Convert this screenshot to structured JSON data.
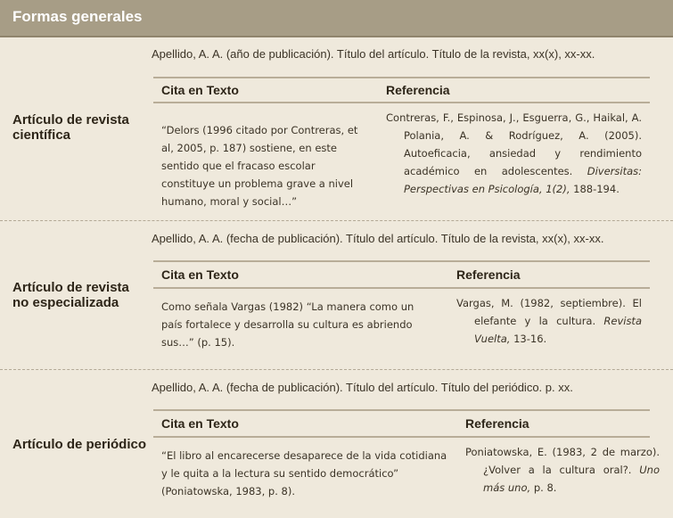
{
  "header": {
    "title": "Formas generales"
  },
  "sections": [
    {
      "title": "Artículo de revista científica",
      "format": "Apellido, A. A. (año de publicación). Título del artículo. Título de la revista, xx(x), xx-xx.",
      "col_cita": "Cita en Texto",
      "col_ref": "Referencia",
      "cita": "“Delors (1996 citado por Contreras, et al, 2005, p. 187) sostiene, en este sentido que el fracaso escolar constituye un problema grave a nivel humano, moral y social…”",
      "ref_plain": "Contreras, F., Espinosa, J., Esguerra, G., Haikal, A. Polania, A. & Rodríguez, A. (2005). Autoeficacia, ansiedad y rendimiento académico en adolescentes. ",
      "ref_italic": "Diversitas: Perspectivas en Psicología, 1(2),",
      "ref_tail": " 188-194."
    },
    {
      "title": "Artículo de revista no especializada",
      "format": "Apellido, A. A. (fecha de publicación). Título del artículo. Título de la revista, xx(x), xx-xx.",
      "col_cita": "Cita en Texto",
      "col_ref": "Referencia",
      "cita": "Como señala Vargas (1982) “La manera como un país fortalece y desarrolla su cultura es abriendo sus…” (p. 15).",
      "ref_plain": "Vargas, M. (1982, septiembre). El elefante y la cultura. ",
      "ref_italic": "Revista Vuelta,",
      "ref_tail": " 13-16."
    },
    {
      "title": "Artículo de periódico",
      "format": "Apellido, A. A. (fecha de publicación). Título del artículo. Título del periódico. p. xx.",
      "col_cita": "Cita en Texto",
      "col_ref": "Referencia",
      "cita": "“El libro al encarecerse desaparece de la vida cotidiana y le quita a la lectura su sentido democrático” (Poniatowska, 1983, p. 8).",
      "ref_plain": "Poniatowska, E. (1983, 2 de marzo). ¿Volver a la cultura oral?. ",
      "ref_italic": "Uno más uno,",
      "ref_tail": " p. 8."
    }
  ]
}
